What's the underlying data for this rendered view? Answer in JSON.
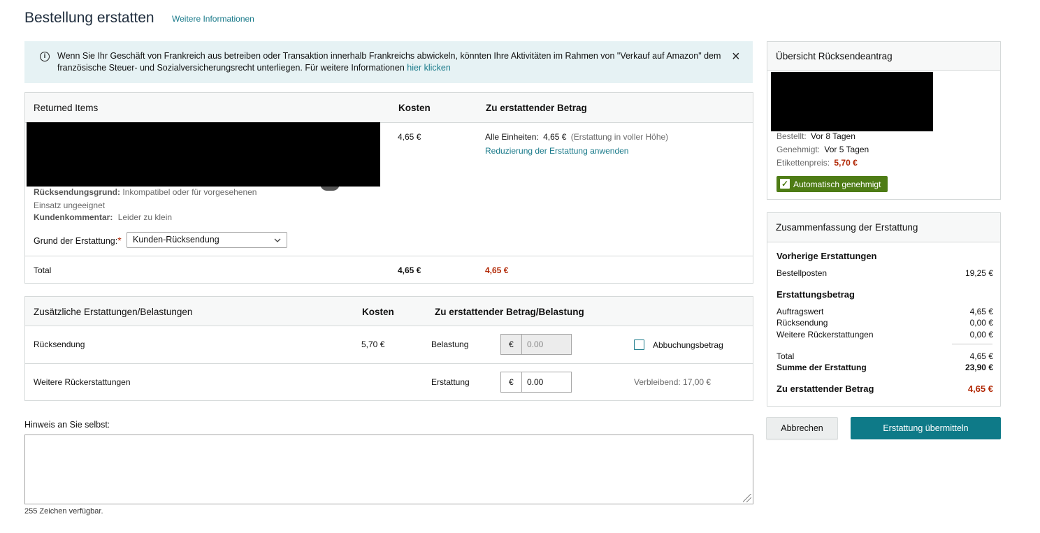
{
  "header": {
    "title": "Bestellung erstatten",
    "more_info": "Weitere Informationen"
  },
  "banner": {
    "text": "Wenn Sie Ihr Geschäft von Frankreich aus betreiben oder Transaktion innerhalb Frankreichs abwickeln, könnten Ihre Aktivitäten im Rahmen von \"Verkauf auf Amazon\" dem französische Steuer- und Sozialversicherungsrecht unterliegen. Für weitere Informationen",
    "link": "hier klicken",
    "close": "×",
    "info_icon": "info-icon"
  },
  "items": {
    "headers": {
      "returned_items": "Returned Items",
      "cost": "Kosten",
      "refund_amount": "Zu erstattender Betrag"
    },
    "item": {
      "cost": "4,65 €",
      "all_units_label": "Alle Einheiten:",
      "all_units_value": "4,65 €",
      "all_units_note": "(Erstattung in voller Höhe)",
      "reduce_link": "Reduzierung der Erstattung anwenden",
      "return_reason_label": "Rücksendungsgrund:",
      "return_reason_value": "Inkompatibel oder für vorgesehenen",
      "return_reason_value_2": "Einsatz ungeeignet",
      "comment_label": "Kundenkommentar:",
      "comment_value": "Leider zu klein",
      "refund_reason_label": "Grund der Erstattung:",
      "required_mark": "*",
      "refund_reason_selected": "Kunden-Rücksendung"
    },
    "total": {
      "label": "Total",
      "cost": "4,65 €",
      "refund": "4,65 €"
    }
  },
  "extra": {
    "headers": {
      "title": "Zusätzliche Erstattungen/Belastungen",
      "cost": "Kosten",
      "amount": "Zu erstattender Betrag/Belastung"
    },
    "rows": [
      {
        "label": "Rücksendung",
        "cost": "5,70 €",
        "type": "Belastung",
        "currency": "€",
        "value": "0.00",
        "checkbox_label": "Abbuchungsbetrag"
      },
      {
        "label": "Weitere Rückerstattungen",
        "cost": "",
        "type": "Erstattung",
        "currency": "€",
        "value": "0.00",
        "remaining": "Verbleibend: 17,00 €"
      }
    ]
  },
  "note": {
    "label": "Hinweis an Sie selbst:",
    "chars_available": "255 Zeichen verfügbar."
  },
  "overview": {
    "title": "Übersicht Rücksendeantrag",
    "ordered_label": "Bestellt:",
    "ordered_value": "Vor 8 Tagen",
    "approved_label": "Genehmigt:",
    "approved_value": "Vor 5 Tagen",
    "label_price_label": "Etikettenpreis:",
    "label_price_value": "5,70 €",
    "badge": "Automatisch genehmigt"
  },
  "summary": {
    "title": "Zusammenfassung der Erstattung",
    "previous_heading": "Vorherige Erstattungen",
    "order_items_label": "Bestellposten",
    "order_items_value": "19,25 €",
    "refund_heading": "Erstattungsbetrag",
    "order_value_label": "Auftragswert",
    "order_value_value": "4,65 €",
    "return_label": "Rücksendung",
    "return_value": "0,00 €",
    "further_label": "Weitere Rückerstattungen",
    "further_value": "0,00 €",
    "total_label": "Total",
    "total_value": "4,65 €",
    "sum_label": "Summe der Erstattung",
    "sum_value": "23,90 €",
    "to_refund_label": "Zu erstattender Betrag",
    "to_refund_value": "4,65 €"
  },
  "actions": {
    "cancel": "Abbrechen",
    "submit": "Erstattung übermitteln"
  },
  "colors": {
    "accent": "#1a7a8a",
    "primary_button": "#0e7a88",
    "price_red": "#b12704",
    "badge_green": "#4e7c15",
    "banner_bg": "#e6f2f4"
  }
}
